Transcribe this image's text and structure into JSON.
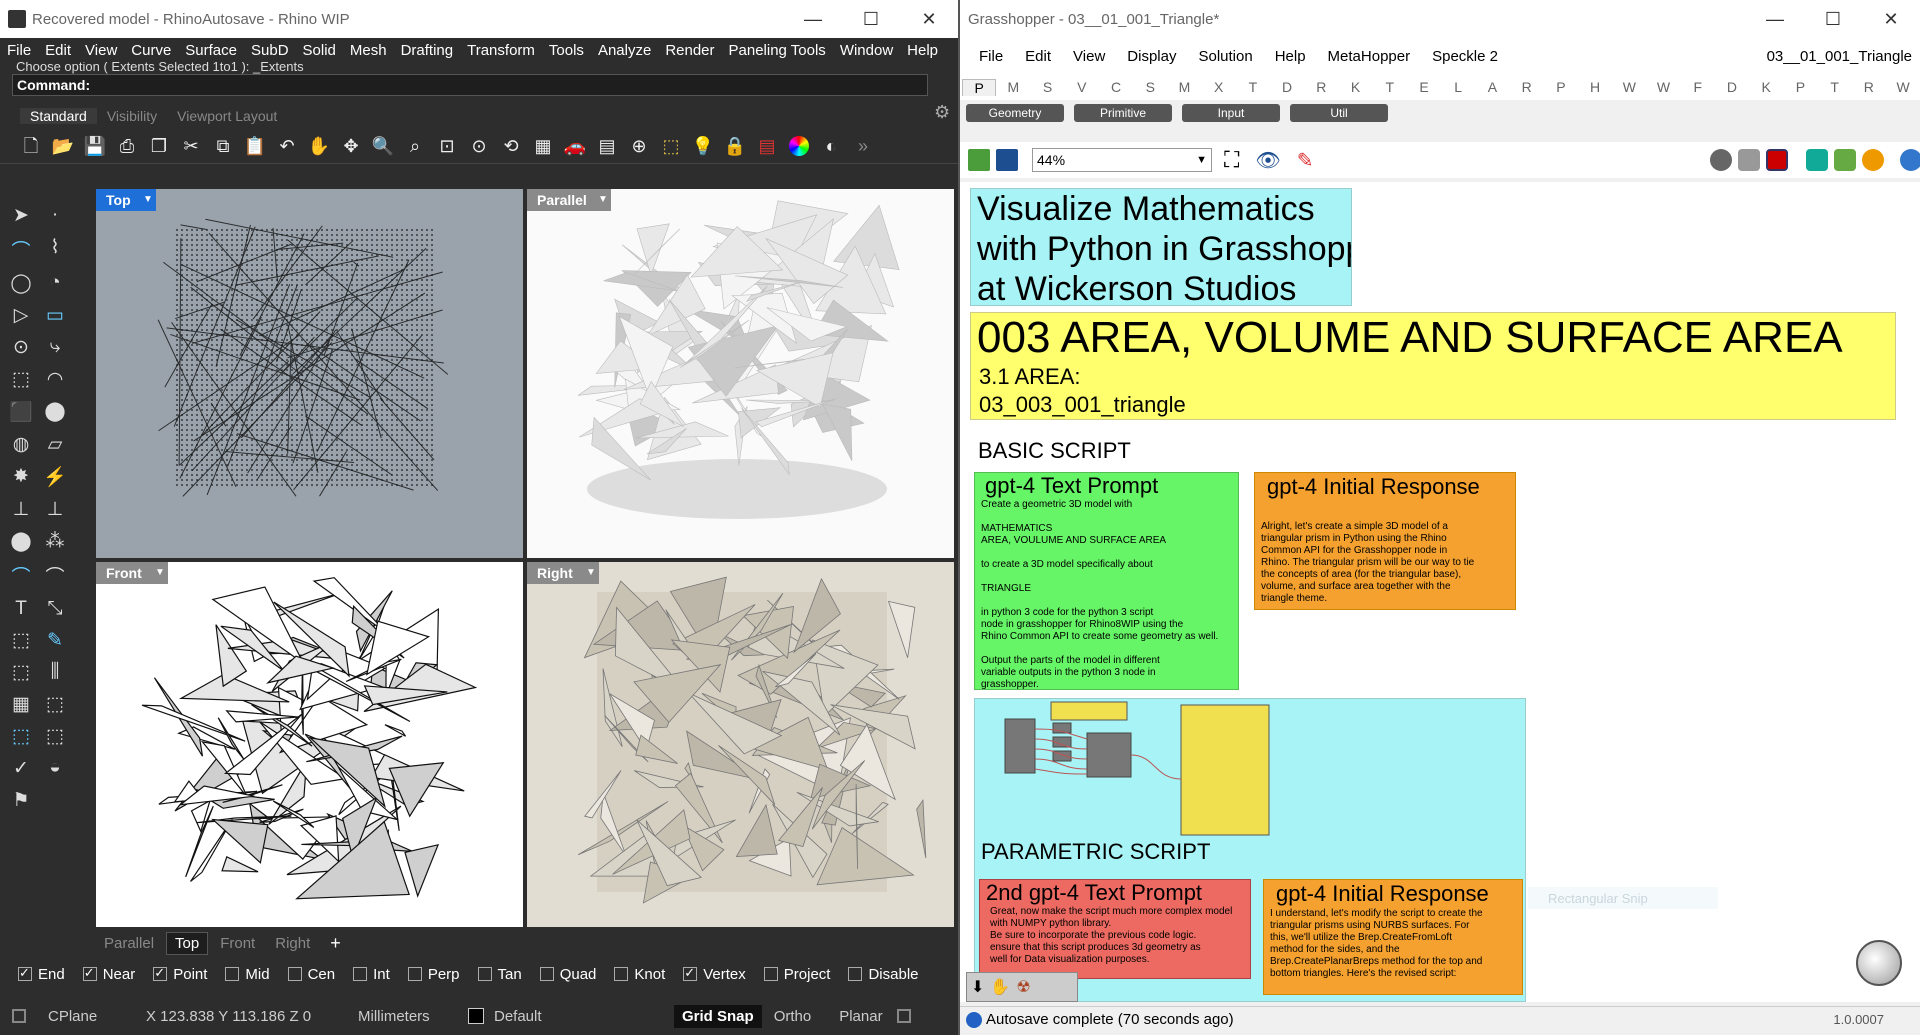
{
  "rhino": {
    "title": "Recovered model - RhinoAutosave - Rhino WIP",
    "menu": [
      "File",
      "Edit",
      "View",
      "Curve",
      "Surface",
      "SubD",
      "Solid",
      "Mesh",
      "Drafting",
      "Transform",
      "Tools",
      "Analyze",
      "Render",
      "Paneling Tools",
      "Window",
      "Help"
    ],
    "history_line": "Choose option ( Extents  Selected  1to1 ): _Extents",
    "command_label": "Command:",
    "toolbar_tabs": [
      "Standard",
      "Visibility",
      "Viewport Layout"
    ],
    "viewports": {
      "top": "Top",
      "parallel": "Parallel",
      "front": "Front",
      "right": "Right"
    },
    "bottom_tabs": [
      "Parallel",
      "Top",
      "Front",
      "Right",
      "+"
    ],
    "snaps": [
      {
        "label": "End",
        "on": true
      },
      {
        "label": "Near",
        "on": true
      },
      {
        "label": "Point",
        "on": true
      },
      {
        "label": "Mid",
        "on": false
      },
      {
        "label": "Cen",
        "on": false
      },
      {
        "label": "Int",
        "on": false
      },
      {
        "label": "Perp",
        "on": false
      },
      {
        "label": "Tan",
        "on": false
      },
      {
        "label": "Quad",
        "on": false
      },
      {
        "label": "Knot",
        "on": false
      },
      {
        "label": "Vertex",
        "on": true
      },
      {
        "label": "Project",
        "on": false
      },
      {
        "label": "Disable",
        "on": false
      }
    ],
    "status": {
      "cplane": "CPlane",
      "coords": "X 123.838 Y 113.186 Z 0",
      "units": "Millimeters",
      "layer": "Default",
      "gridsnap": "Grid Snap",
      "ortho": "Ortho",
      "planar": "Planar"
    }
  },
  "gh": {
    "title": "Grasshopper - 03__01_001_Triangle*",
    "menu": [
      "File",
      "Edit",
      "View",
      "Display",
      "Solution",
      "Help",
      "MetaHopper",
      "Speckle 2"
    ],
    "doc_name": "03__01_001_Triangle",
    "tabs": [
      "P",
      "M",
      "S",
      "V",
      "C",
      "S",
      "M",
      "X",
      "T",
      "D",
      "R",
      "K",
      "T",
      "E",
      "L",
      "A",
      "R",
      "P",
      "H",
      "W",
      "W",
      "F",
      "D",
      "K",
      "P",
      "T",
      "R",
      "W"
    ],
    "categories": [
      "Geometry",
      "Primitive",
      "Input",
      "Util"
    ],
    "zoom": "44%",
    "header_title": "Visualize Mathematics\nwith Python in Grasshopper\nat Wickerson Studios",
    "section_title": "003 AREA, VOLUME AND SURFACE AREA",
    "section_sub1": "3.1 AREA:",
    "section_sub2": "03_003_001_triangle",
    "basic_script": "BASIC SCRIPT",
    "prompt_title": "gpt-4 Text Prompt",
    "prompt_body": "Create a geometric 3D model with\n\nMATHEMATICS\nAREA, VOULUME AND SURFACE AREA\n\nto create a 3D model specifically about\n\nTRIANGLE\n\nin python 3 code for the python 3 script\nnode in grasshopper for Rhino8WIP using the\nRhino Common API to create some geometry as well.\n\nOutput the parts of the model in different\nvariable outputs in the python 3 node in\ngrasshopper.",
    "response_title": "gpt-4 Initial Response",
    "response_body": "Alright, let's create a simple 3D model of a\ntriangular prism in Python using the Rhino\nCommon API for the Grasshopper node in\nRhino. The triangular prism will be our way to tie\nthe concepts of area (for the triangular base),\nvolume, and surface area together with the\ntriangle theme.",
    "parametric_script": "PARAMETRIC SCRIPT",
    "prompt2_title": "2nd gpt-4 Text Prompt",
    "prompt2_body": "Great, now make the script much more complex model\nwith NUMPY python library.\nBe sure to incorporate the previous code logic.\nensure that this script produces 3d geometry as\nwell for Data visualization purposes.",
    "response2_title": "gpt-4 Initial Response",
    "response2_body": "I understand, let's modify the script to create the\ntriangular prisms using NURBS surfaces. For\nthis, we'll utilize the Brep.CreateFromLoft\nmethod for the sides, and the\nBrep.CreatePlanarBreps method for the top and\nbottom triangles. Here's the revised script:",
    "snip_label": "Rectangular Snip",
    "status": "Autosave complete (70 seconds ago)",
    "version": "1.0.0007"
  }
}
